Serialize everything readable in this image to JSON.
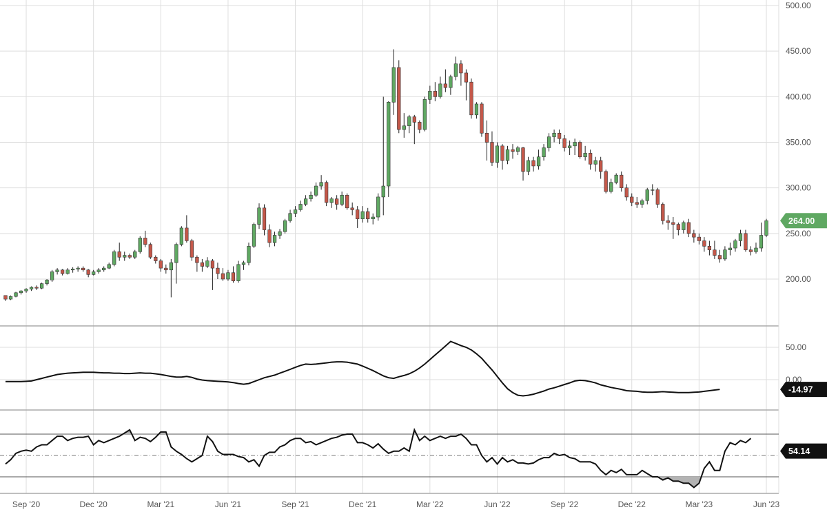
{
  "colors": {
    "up": "#5fa862",
    "down": "#c4584a",
    "grid": "#dddddd",
    "line": "#111111",
    "separator": "#aaaaaa",
    "axis_text": "#555555",
    "current_badge": "#5fa862",
    "indicator_badge": "#111111",
    "rsi_fill": "#b3b3b3"
  },
  "chart_data": [
    {
      "type": "candlestick",
      "panel": "price",
      "title": "",
      "ylim": [
        175,
        500
      ],
      "y_ticks": [
        "200.00",
        "250.00",
        "300.00",
        "350.00",
        "400.00",
        "450.00",
        "500.00"
      ],
      "x_ticks": [
        "Sep '20",
        "Dec '20",
        "Mar '21",
        "Jun '21",
        "Sep '21",
        "Dec '21",
        "Mar '22",
        "Jun '22",
        "Sep '22",
        "Dec '22",
        "Mar '23",
        "Jun '23"
      ],
      "x_tick_index": [
        4,
        17,
        30,
        43,
        56,
        69,
        82,
        95,
        108,
        121,
        134,
        147
      ],
      "grid": true,
      "current_value": "264.00",
      "ohlc": [
        [
          182,
          180,
          176,
          178
        ],
        [
          178,
          182,
          177,
          181
        ],
        [
          181,
          186,
          180,
          185
        ],
        [
          185,
          188,
          183,
          187
        ],
        [
          187,
          190,
          185,
          189
        ],
        [
          189,
          192,
          187,
          191
        ],
        [
          191,
          193,
          188,
          190
        ],
        [
          190,
          196,
          189,
          195
        ],
        [
          195,
          200,
          193,
          199
        ],
        [
          199,
          210,
          197,
          208
        ],
        [
          208,
          212,
          205,
          210
        ],
        [
          210,
          211,
          204,
          206
        ],
        [
          206,
          212,
          205,
          210
        ],
        [
          210,
          213,
          207,
          211
        ],
        [
          211,
          214,
          208,
          212
        ],
        [
          212,
          214,
          208,
          210
        ],
        [
          210,
          211,
          202,
          205
        ],
        [
          205,
          210,
          204,
          208
        ],
        [
          208,
          212,
          206,
          210
        ],
        [
          210,
          214,
          208,
          212
        ],
        [
          212,
          218,
          211,
          216
        ],
        [
          216,
          232,
          214,
          230
        ],
        [
          230,
          240,
          220,
          224
        ],
        [
          224,
          230,
          220,
          226
        ],
        [
          226,
          228,
          222,
          224
        ],
        [
          224,
          232,
          222,
          230
        ],
        [
          230,
          247,
          228,
          245
        ],
        [
          245,
          253,
          235,
          238
        ],
        [
          238,
          240,
          222,
          224
        ],
        [
          224,
          226,
          217,
          220
        ],
        [
          220,
          222,
          208,
          212
        ],
        [
          212,
          216,
          206,
          210
        ],
        [
          210,
          222,
          180,
          218
        ],
        [
          218,
          240,
          195,
          238
        ],
        [
          238,
          258,
          236,
          256
        ],
        [
          256,
          270,
          240,
          242
        ],
        [
          242,
          244,
          220,
          224
        ],
        [
          224,
          226,
          208,
          218
        ],
        [
          218,
          222,
          208,
          214
        ],
        [
          214,
          224,
          212,
          220
        ],
        [
          220,
          222,
          188,
          212
        ],
        [
          212,
          218,
          200,
          206
        ],
        [
          206,
          212,
          198,
          200
        ],
        [
          200,
          210,
          198,
          207
        ],
        [
          207,
          214,
          196,
          198
        ],
        [
          198,
          220,
          196,
          216
        ],
        [
          216,
          220,
          210,
          218
        ],
        [
          218,
          240,
          215,
          236
        ],
        [
          236,
          262,
          234,
          260
        ],
        [
          260,
          283,
          255,
          278
        ],
        [
          278,
          282,
          248,
          254
        ],
        [
          254,
          260,
          235,
          240
        ],
        [
          240,
          252,
          236,
          248
        ],
        [
          248,
          255,
          244,
          252
        ],
        [
          252,
          266,
          250,
          264
        ],
        [
          264,
          276,
          262,
          272
        ],
        [
          272,
          280,
          268,
          276
        ],
        [
          276,
          286,
          274,
          282
        ],
        [
          282,
          292,
          280,
          288
        ],
        [
          288,
          296,
          285,
          292
        ],
        [
          292,
          306,
          290,
          302
        ],
        [
          302,
          314,
          298,
          306
        ],
        [
          306,
          308,
          280,
          284
        ],
        [
          284,
          290,
          278,
          288
        ],
        [
          288,
          292,
          276,
          282
        ],
        [
          282,
          296,
          280,
          292
        ],
        [
          292,
          294,
          276,
          278
        ],
        [
          278,
          284,
          270,
          276
        ],
        [
          276,
          280,
          256,
          266
        ],
        [
          266,
          280,
          262,
          274
        ],
        [
          274,
          278,
          262,
          266
        ],
        [
          266,
          272,
          260,
          268
        ],
        [
          268,
          294,
          264,
          290
        ],
        [
          290,
          400,
          270,
          302
        ],
        [
          302,
          395,
          290,
          394
        ],
        [
          394,
          452,
          380,
          432
        ],
        [
          432,
          440,
          360,
          364
        ],
        [
          364,
          382,
          355,
          368
        ],
        [
          368,
          380,
          360,
          378
        ],
        [
          378,
          380,
          348,
          372
        ],
        [
          372,
          374,
          360,
          364
        ],
        [
          364,
          400,
          362,
          397
        ],
        [
          397,
          412,
          392,
          406
        ],
        [
          406,
          416,
          395,
          400
        ],
        [
          400,
          422,
          398,
          414
        ],
        [
          414,
          430,
          405,
          410
        ],
        [
          410,
          424,
          402,
          422
        ],
        [
          422,
          444,
          418,
          436
        ],
        [
          436,
          440,
          412,
          426
        ],
        [
          426,
          430,
          396,
          416
        ],
        [
          416,
          420,
          376,
          380
        ],
        [
          380,
          394,
          376,
          392
        ],
        [
          392,
          394,
          356,
          360
        ],
        [
          360,
          374,
          330,
          350
        ],
        [
          350,
          362,
          324,
          328
        ],
        [
          328,
          350,
          322,
          346
        ],
        [
          346,
          348,
          320,
          330
        ],
        [
          330,
          346,
          326,
          342
        ],
        [
          342,
          348,
          332,
          340
        ],
        [
          340,
          346,
          336,
          344
        ],
        [
          344,
          345,
          308,
          318
        ],
        [
          318,
          334,
          314,
          330
        ],
        [
          330,
          334,
          318,
          324
        ],
        [
          324,
          342,
          320,
          334
        ],
        [
          334,
          348,
          330,
          344
        ],
        [
          344,
          360,
          340,
          356
        ],
        [
          356,
          364,
          350,
          360
        ],
        [
          360,
          364,
          348,
          354
        ],
        [
          354,
          358,
          340,
          344
        ],
        [
          344,
          352,
          336,
          346
        ],
        [
          346,
          354,
          336,
          350
        ],
        [
          350,
          352,
          332,
          334
        ],
        [
          334,
          346,
          330,
          338
        ],
        [
          338,
          342,
          320,
          326
        ],
        [
          326,
          334,
          318,
          330
        ],
        [
          330,
          334,
          310,
          318
        ],
        [
          318,
          320,
          294,
          296
        ],
        [
          296,
          310,
          294,
          306
        ],
        [
          306,
          316,
          304,
          314
        ],
        [
          314,
          318,
          296,
          300
        ],
        [
          300,
          304,
          286,
          290
        ],
        [
          290,
          294,
          280,
          284
        ],
        [
          284,
          290,
          278,
          282
        ],
        [
          282,
          288,
          278,
          286
        ],
        [
          286,
          300,
          282,
          298
        ],
        [
          298,
          304,
          292,
          298
        ],
        [
          298,
          300,
          278,
          282
        ],
        [
          282,
          284,
          260,
          264
        ],
        [
          264,
          270,
          254,
          262
        ],
        [
          262,
          268,
          244,
          260
        ],
        [
          260,
          262,
          248,
          254
        ],
        [
          254,
          264,
          250,
          262
        ],
        [
          262,
          266,
          246,
          250
        ],
        [
          250,
          254,
          240,
          246
        ],
        [
          246,
          250,
          238,
          242
        ],
        [
          242,
          246,
          230,
          236
        ],
        [
          236,
          242,
          226,
          232
        ],
        [
          232,
          242,
          222,
          226
        ],
        [
          226,
          232,
          218,
          222
        ],
        [
          222,
          236,
          220,
          232
        ],
        [
          232,
          240,
          226,
          234
        ],
        [
          234,
          244,
          230,
          242
        ],
        [
          242,
          254,
          236,
          250
        ],
        [
          250,
          254,
          230,
          232
        ],
        [
          232,
          236,
          226,
          230
        ],
        [
          230,
          240,
          228,
          234
        ],
        [
          234,
          262,
          230,
          248
        ],
        [
          248,
          266,
          246,
          264
        ]
      ]
    },
    {
      "type": "line",
      "panel": "momentum",
      "ylim": [
        -45,
        70
      ],
      "y_ticks": [
        "0.00",
        "50.00"
      ],
      "current_value": "-14.97",
      "values": [
        -3,
        -3,
        -3,
        -3,
        -2.5,
        -2,
        0,
        2,
        4,
        6,
        8,
        9,
        10,
        10.5,
        11,
        11.5,
        11.5,
        11.5,
        11,
        10.5,
        10.5,
        10,
        10,
        9.5,
        9.5,
        10,
        10.5,
        10,
        10,
        9,
        8,
        6.5,
        5,
        4,
        4,
        5,
        3.5,
        1,
        -0.5,
        -1.5,
        -2,
        -2.5,
        -3,
        -3.5,
        -4.5,
        -6,
        -7,
        -6,
        -3,
        0,
        3,
        5,
        7,
        10,
        13,
        16,
        19,
        22,
        24,
        23.5,
        24,
        25,
        26,
        27,
        27.5,
        27.5,
        27,
        25.5,
        24,
        21,
        17.5,
        14,
        10,
        6,
        3,
        2,
        4.5,
        6.5,
        9,
        13,
        18,
        24,
        31,
        38,
        45,
        52,
        59,
        56,
        52.5,
        50,
        46,
        40,
        33,
        24,
        15,
        5,
        -5,
        -14,
        -20,
        -24,
        -25,
        -24,
        -22.5,
        -20,
        -17.5,
        -14.5,
        -12.5,
        -10,
        -7.5,
        -5,
        -2,
        -1,
        -1.5,
        -3,
        -5,
        -8,
        -10,
        -12,
        -13.5,
        -15,
        -17,
        -17.5,
        -18,
        -19,
        -19.5,
        -19.5,
        -19,
        -18.5,
        -19,
        -19.5,
        -20,
        -20,
        -20,
        -19.5,
        -19,
        -18,
        -17,
        -16,
        -15
      ]
    },
    {
      "type": "line",
      "panel": "oscillator",
      "ylim": [
        20,
        82
      ],
      "levels": [
        70,
        50,
        30
      ],
      "current_value": "54.14",
      "values": [
        42,
        46,
        52,
        54,
        55,
        54,
        58,
        60,
        60,
        64,
        68,
        68,
        64,
        66,
        67,
        67,
        68,
        60,
        64,
        62,
        64,
        66,
        68,
        71,
        74,
        64,
        67,
        66,
        63,
        67,
        72,
        72,
        58,
        54,
        51,
        47,
        44,
        47,
        50,
        68,
        63,
        54,
        51,
        51,
        51,
        49,
        48,
        44,
        46,
        40,
        50,
        53,
        53,
        58,
        60,
        64,
        66,
        66,
        62,
        63,
        60,
        62,
        64,
        66,
        67,
        69,
        70,
        70,
        62,
        62,
        60,
        57,
        61,
        56,
        52,
        54,
        54,
        57,
        54,
        74,
        64,
        68,
        64,
        66,
        68,
        66,
        68,
        68,
        70,
        66,
        60,
        60,
        50,
        44,
        48,
        42,
        48,
        44,
        46,
        43,
        43,
        42,
        43,
        46,
        48,
        48,
        52,
        50,
        51,
        48,
        47,
        44,
        44,
        44,
        42,
        36,
        32,
        36,
        34,
        37,
        32,
        32,
        32,
        36,
        33,
        30,
        30,
        27,
        29,
        26,
        26,
        24,
        24,
        20,
        24,
        38,
        44,
        36,
        36,
        54,
        62,
        60,
        64,
        62,
        66
      ]
    }
  ]
}
